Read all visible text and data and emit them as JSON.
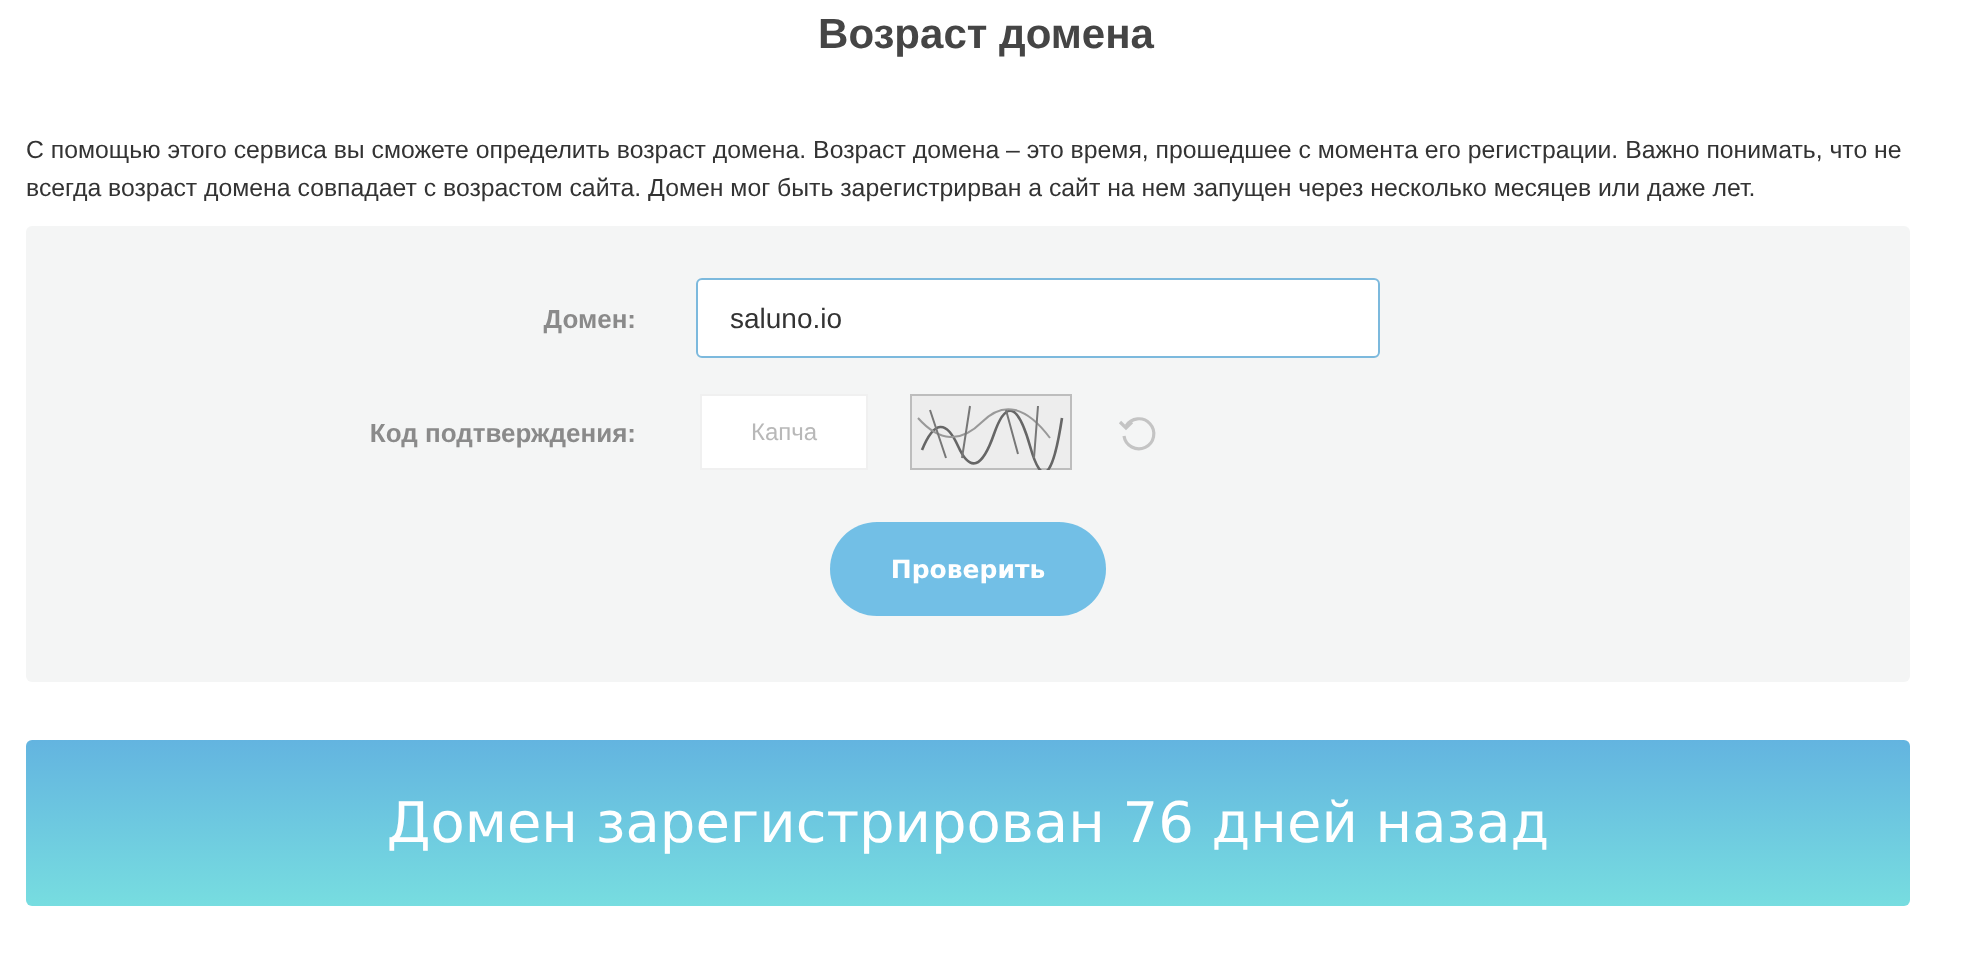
{
  "title": "Возраст домена",
  "description": "С помощью этого сервиса вы сможете определить возраст домена. Возраст домена – это время, прошедшее с момента его регистрации. Важно понимать, что не всегда возраст домена совпадает с возрастом сайта. Домен мог быть зарегистрирван а сайт на нем запущен через несколько месяцев или даже лет.",
  "form": {
    "domain": {
      "label": "Домен:",
      "value": "saluno.io"
    },
    "captcha": {
      "label": "Код подтверждения:",
      "placeholder": "Капча"
    },
    "submit": "Проверить"
  },
  "result": "Домен зарегистрирован 76 дней назад"
}
